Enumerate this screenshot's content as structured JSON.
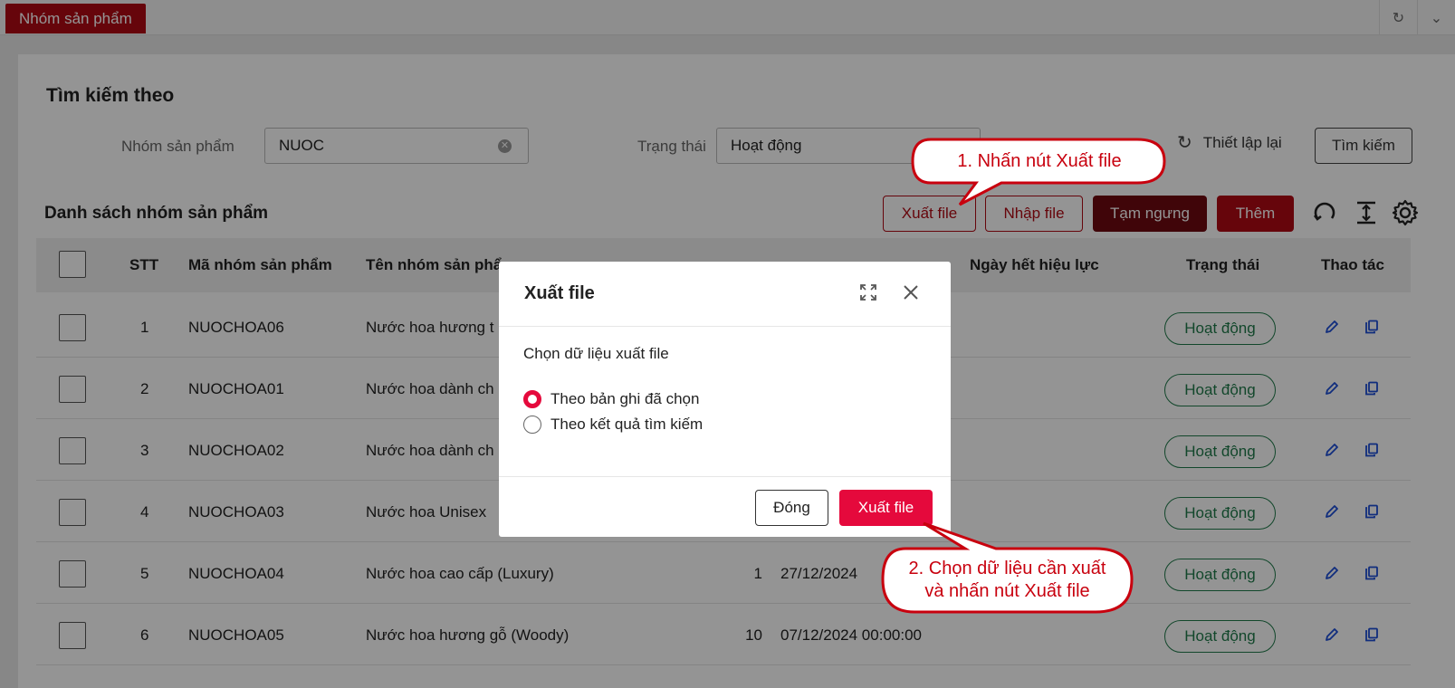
{
  "topbar": {
    "tab_label": "Nhóm sản phẩm",
    "icons": [
      "refresh-icon",
      "chevron-down-icon"
    ]
  },
  "search": {
    "title": "Tìm kiếm theo",
    "group_label": "Nhóm sản phẩm",
    "group_value": "NUOC",
    "status_label": "Trạng thái",
    "status_value": "Hoạt động",
    "reset_label": "Thiết lập lại",
    "search_label": "Tìm kiếm"
  },
  "list": {
    "title": "Danh sách nhóm sản phẩm",
    "export_label": "Xuất file",
    "import_label": "Nhập file",
    "pause_label": "Tạm ngưng",
    "add_label": "Thêm",
    "colors": {
      "primary": "#b00a13",
      "pause": "#6e0a10",
      "accent": "#e5093c",
      "status": "#1f7a4a"
    }
  },
  "table": {
    "headers": {
      "stt": "STT",
      "code": "Mã nhóm sản phẩm",
      "name": "Tên nhóm sản phẩm",
      "expiry": "Ngày hết hiệu lực",
      "status": "Trạng thái",
      "actions": "Thao tác"
    },
    "rows": [
      {
        "stt": "1",
        "code": "NUOCHOA06",
        "name": "Nước hoa hương t",
        "count": "",
        "date": "",
        "status": "Hoạt động"
      },
      {
        "stt": "2",
        "code": "NUOCHOA01",
        "name": "Nước hoa dành ch",
        "count": "",
        "date": "",
        "status": "Hoạt động"
      },
      {
        "stt": "3",
        "code": "NUOCHOA02",
        "name": "Nước hoa dành ch",
        "count": "",
        "date": "",
        "status": "Hoạt động"
      },
      {
        "stt": "4",
        "code": "NUOCHOA03",
        "name": "Nước hoa Unisex",
        "count": "",
        "date": "",
        "status": "Hoạt động"
      },
      {
        "stt": "5",
        "code": "NUOCHOA04",
        "name": "Nước hoa cao cấp (Luxury)",
        "count": "1",
        "date": "27/12/2024",
        "status": "Hoạt động"
      },
      {
        "stt": "6",
        "code": "NUOCHOA05",
        "name": "Nước hoa hương gỗ (Woody)",
        "count": "10",
        "date": "07/12/2024 00:00:00",
        "status": "Hoạt động"
      }
    ]
  },
  "modal": {
    "title": "Xuất file",
    "label": "Chọn dữ liệu xuất file",
    "option1": "Theo bản ghi đã chọn",
    "option2": "Theo kết quả tìm kiếm",
    "selected_option": "option1",
    "close_label": "Đóng",
    "export_label": "Xuất file"
  },
  "callouts": {
    "step1": "1. Nhấn nút Xuất file",
    "step2_line1": "2. Chọn dữ liệu cần xuất",
    "step2_line2": "và nhấn nút Xuất file"
  }
}
